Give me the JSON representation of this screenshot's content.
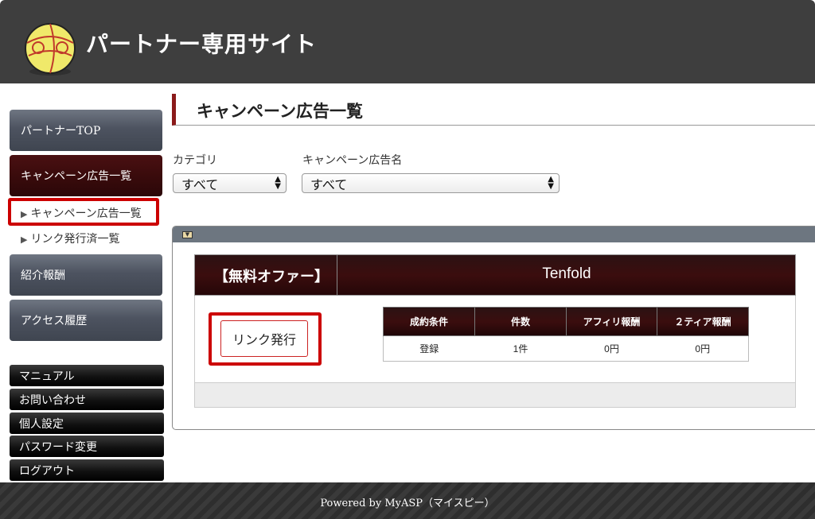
{
  "header": {
    "title": "パートナー専用サイト",
    "logo_icon": "partner-logo-ball-icon"
  },
  "sidebar": {
    "top_label": "パートナーTOP",
    "campaign_label": "キャンペーン広告一覧",
    "sub_items": [
      {
        "label": "キャンペーン広告一覧",
        "icon": "triangle-right-icon"
      },
      {
        "label": "リンク発行済一覧",
        "icon": "triangle-right-icon"
      }
    ],
    "reward_label": "紹介報酬",
    "access_label": "アクセス履歴",
    "bottom_items": [
      "マニュアル",
      "お問い合わせ",
      "個人設定",
      "パスワード変更",
      "ログアウト"
    ]
  },
  "main": {
    "heading": "キャンペーン広告一覧",
    "filters": {
      "category_label": "カテゴリ",
      "category_value": "すべて",
      "campaign_name_label": "キャンペーン広告名",
      "campaign_name_value": "すべて"
    },
    "offer": {
      "tag": "【無料オファー】",
      "name": "Tenfold",
      "button_label": "リンク発行",
      "table_headers": [
        "成約条件",
        "件数",
        "アフィリ報酬",
        "２ティア報酬"
      ],
      "table_row": [
        "登録",
        "1件",
        "0円",
        "0円"
      ]
    }
  },
  "footer": {
    "text": "Powered by MyASP（マイスピー）"
  },
  "colors": {
    "header_bg": "#3e3e3e",
    "accent_red": "#cc0000",
    "maroon": "#3a0b0c"
  }
}
